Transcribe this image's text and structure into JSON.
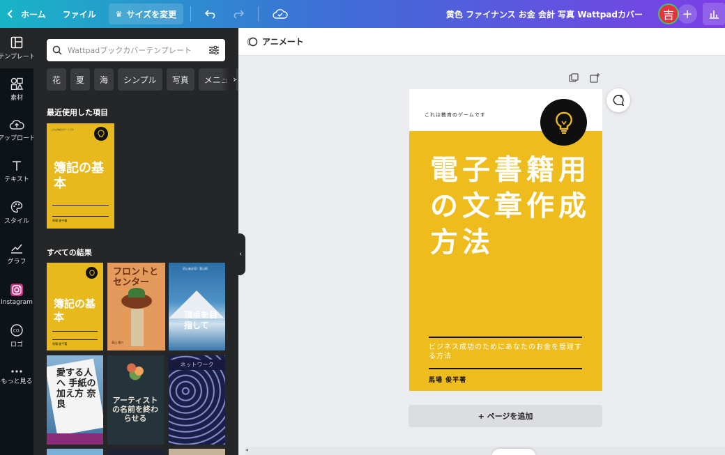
{
  "topbar": {
    "home_label": "ホーム",
    "file_label": "ファイル",
    "resize_label": "サイズを変更",
    "title": "黄色 ファイナンス お金 会計 写真 Wattpadカバー",
    "avatar_initial": "吉",
    "plus_label": "+"
  },
  "rail": {
    "items": [
      {
        "label": "テンプレート",
        "icon": "template-icon"
      },
      {
        "label": "素材",
        "icon": "elements-icon"
      },
      {
        "label": "アップロード",
        "icon": "upload-icon"
      },
      {
        "label": "テキスト",
        "icon": "text-icon"
      },
      {
        "label": "スタイル",
        "icon": "palette-icon"
      },
      {
        "label": "グラフ",
        "icon": "chart-icon"
      },
      {
        "label": "Instagram",
        "icon": "instagram-icon"
      },
      {
        "label": "ロゴ",
        "icon": "logo-icon"
      },
      {
        "label": "もっと見る",
        "icon": "more-icon"
      }
    ]
  },
  "panel": {
    "search_placeholder": "Wattpadブックカバーテンプレート",
    "chips": [
      "花",
      "夏",
      "海",
      "シンプル",
      "写真",
      "メニュー"
    ],
    "recent_title": "最近使用した項目",
    "all_results_title": "すべての結果",
    "recent_thumb": {
      "title": "簿記の基本",
      "hint": "これは簿記のゲームです",
      "author": "馬場 俊平著"
    },
    "results": [
      {
        "title": "簿記の基本",
        "author": "馬場 俊平著"
      },
      {
        "title": "フロントとセンター",
        "author": "真山 陽介"
      },
      {
        "title": "頂点を目指して",
        "small": "初心者必見！登山術"
      },
      {
        "title": "愛する人へ 手紙の加え方 奈良"
      },
      {
        "title": "アーティストの名前を終わらせる"
      },
      {
        "title": "ネットワーク"
      }
    ],
    "collapse_icon": "‹"
  },
  "editor": {
    "animate_label": "アニメート",
    "add_page_label": "+ ページを追加",
    "page": {
      "hint": "これは教育のゲームです",
      "title": "電子書籍用の文章作成方法",
      "subtitle": "ビジネス成功のためにあなたのお金を管理する方法",
      "author": "馬場 俊平著"
    }
  },
  "colors": {
    "accent_yellow": "#eebd1d",
    "panel_bg": "#252627",
    "rail_bg": "#0e1318"
  }
}
